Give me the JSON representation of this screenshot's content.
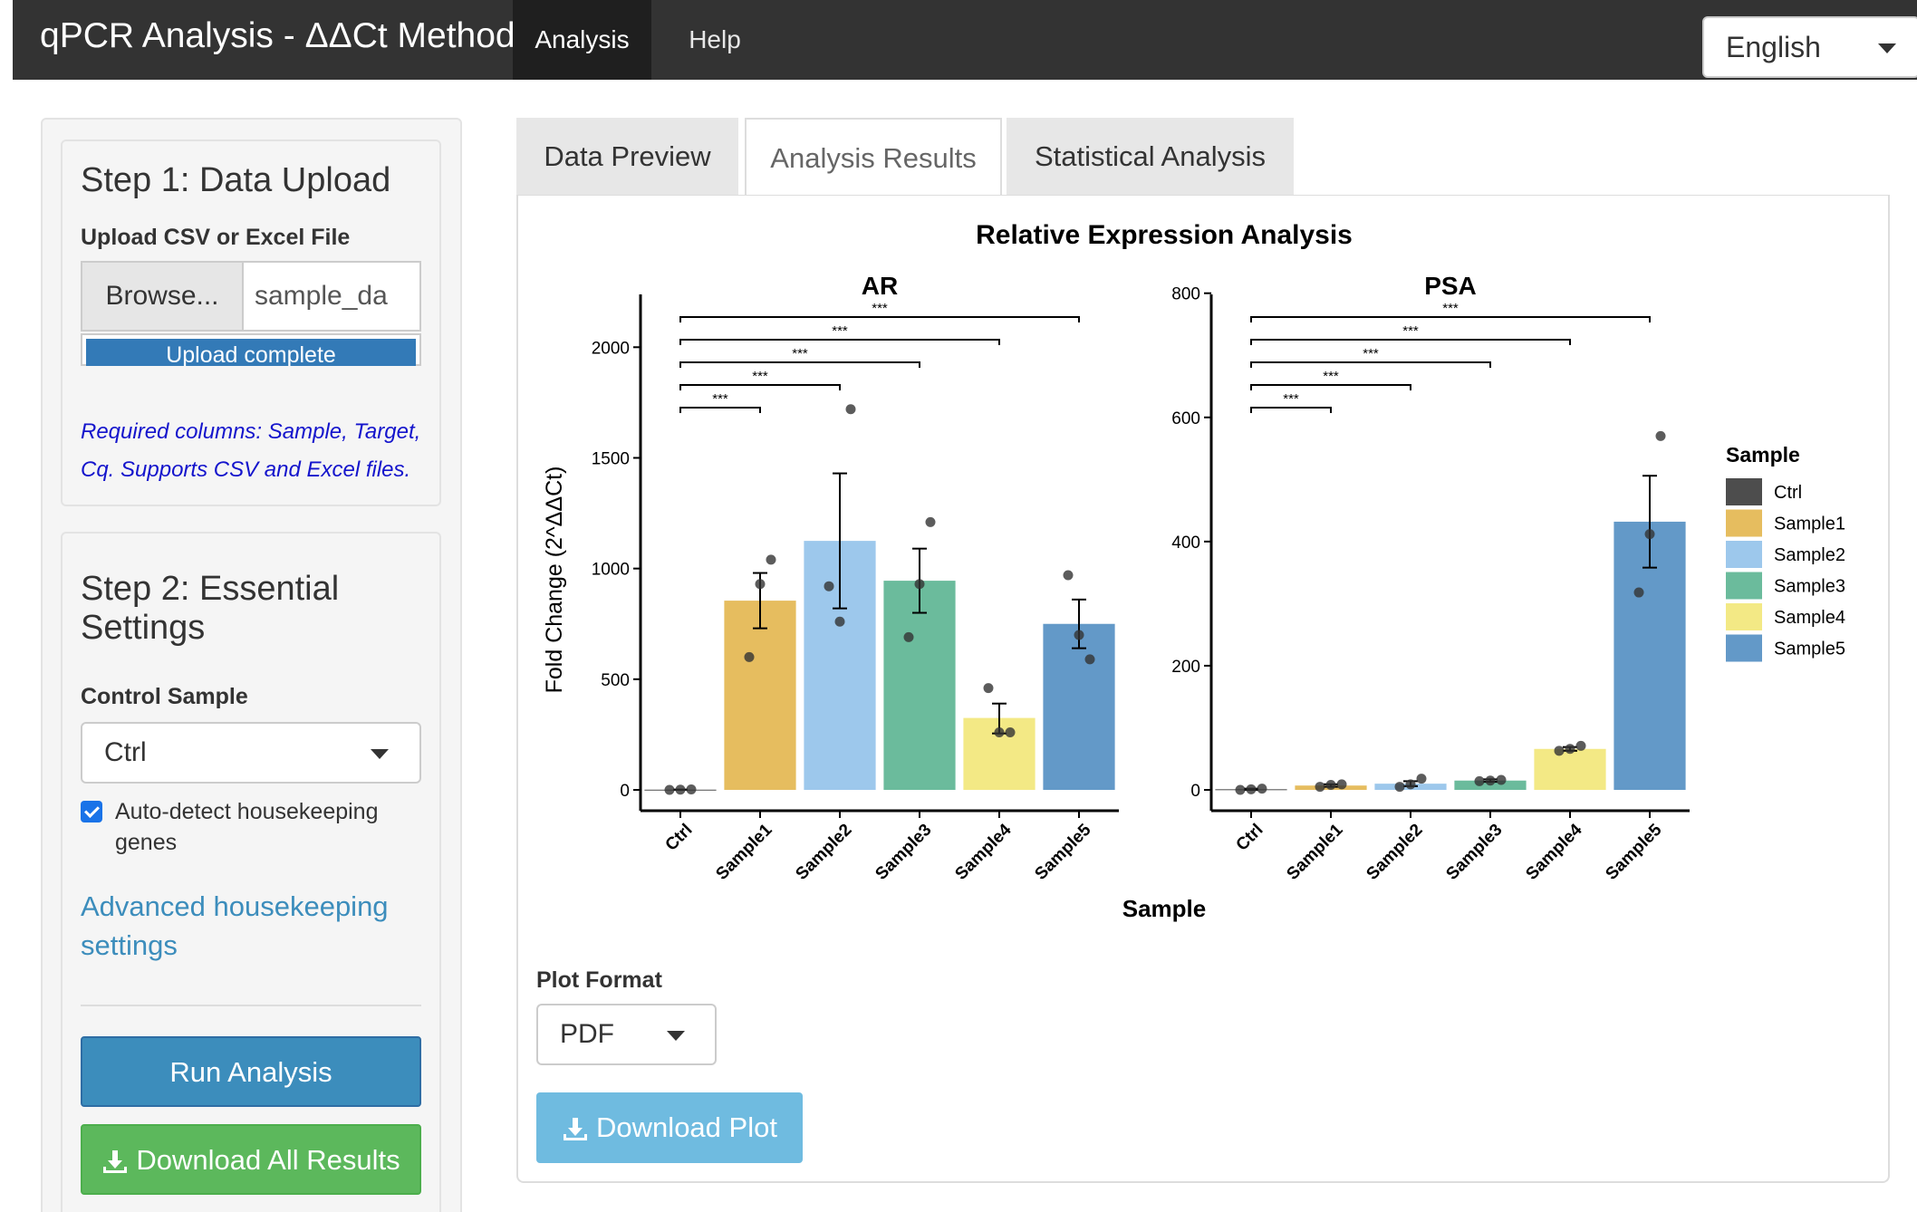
{
  "navbar": {
    "title": "qPCR Analysis - ΔΔCt Method",
    "tabs": [
      "Analysis",
      "Help"
    ],
    "language": "English"
  },
  "sidebar": {
    "step1": {
      "title": "Step 1: Data Upload",
      "upload_label": "Upload CSV or Excel File",
      "browse_label": "Browse...",
      "file_name": "sample_da",
      "progress_text": "Upload complete",
      "progress": 1.0,
      "help": "Required columns: Sample, Target, Cq. Supports CSV and Excel files."
    },
    "step2": {
      "title": "Step 2: Essential Settings",
      "control_label": "Control Sample",
      "control_value": "Ctrl",
      "checkbox_label": "Auto-detect housekeeping genes",
      "checkbox_checked": true,
      "advanced_link": "Advanced housekeeping settings",
      "run_button": "Run Analysis",
      "download_all_button": "Download All Results"
    }
  },
  "main": {
    "tabs": [
      "Data Preview",
      "Analysis Results",
      "Statistical Analysis"
    ],
    "active_tab": "Analysis Results",
    "plot_format_label": "Plot Format",
    "plot_format_value": "PDF",
    "download_plot_button": "Download Plot"
  },
  "colors": {
    "Ctrl": "#4d4d4d",
    "Sample1": "#e6bd5f",
    "Sample2": "#9dc8ec",
    "Sample3": "#6bbb9c",
    "Sample4": "#f3e985",
    "Sample5": "#6399c8",
    "navbar": "#333333",
    "primary": "#3c8dbc",
    "success": "#5cb85c"
  },
  "chart_data": {
    "type": "bar",
    "title": "Relative Expression Analysis",
    "xlabel": "Sample",
    "ylabel": "Fold Change (2^ΔΔCt)",
    "categories": [
      "Ctrl",
      "Sample1",
      "Sample2",
      "Sample3",
      "Sample4",
      "Sample5"
    ],
    "legend_title": "Sample",
    "legend_position": "right",
    "significance_label": "***",
    "panels": [
      {
        "name": "AR",
        "ylim": [
          0,
          2300
        ],
        "yticks": [
          0,
          500,
          1000,
          1500,
          2000
        ],
        "values": [
          1,
          855,
          1125,
          945,
          325,
          750
        ],
        "error": [
          [
            1,
            1
          ],
          [
            730,
            980
          ],
          [
            820,
            1430
          ],
          [
            800,
            1090
          ],
          [
            255,
            390
          ],
          [
            640,
            860
          ]
        ],
        "points": [
          [
            0,
            1,
            2
          ],
          [
            600,
            930,
            1040
          ],
          [
            920,
            760,
            1720
          ],
          [
            690,
            930,
            1210
          ],
          [
            460,
            260,
            260
          ],
          [
            970,
            700,
            590
          ]
        ]
      },
      {
        "name": "PSA",
        "ylim": [
          0,
          820
        ],
        "yticks": [
          0,
          200,
          400,
          600,
          800
        ],
        "values": [
          1,
          7,
          10,
          15,
          66,
          432
        ],
        "error": [
          [
            0,
            2
          ],
          [
            5,
            9
          ],
          [
            6,
            14
          ],
          [
            13,
            17
          ],
          [
            63,
            69
          ],
          [
            358,
            506
          ]
        ],
        "points": [
          [
            0,
            1,
            2
          ],
          [
            5,
            8,
            9
          ],
          [
            5,
            9,
            18
          ],
          [
            14,
            15,
            16
          ],
          [
            63,
            66,
            71
          ],
          [
            318,
            412,
            570
          ]
        ]
      }
    ]
  }
}
